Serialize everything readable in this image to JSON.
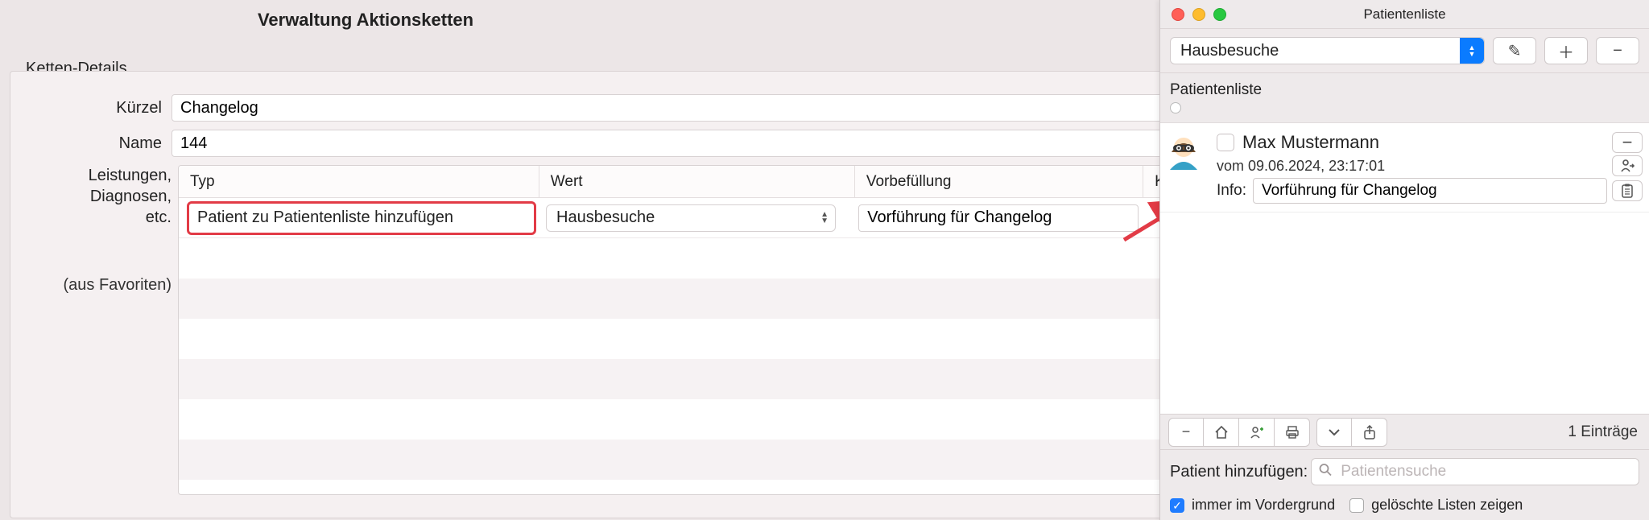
{
  "main": {
    "title": "Verwaltung Aktionsketten",
    "details_label": "Ketten-Details",
    "fields": {
      "kürzel_label": "Kürzel",
      "kürzel_value": "Changelog",
      "name_label": "Name",
      "name_value": "144",
      "multi_label": "Leistungen,\nDiagnosen,\netc.",
      "favoriten_label": "(aus Favoriten)"
    },
    "table": {
      "headers": {
        "typ": "Typ",
        "wert": "Wert",
        "vor": "Vorbefüllung",
        "k": "K"
      },
      "row": {
        "typ": "Patient zu Patientenliste hinzufügen",
        "wert": "Hausbesuche",
        "vor": "Vorführung für Changelog"
      }
    }
  },
  "popover": {
    "title": "Patientenliste",
    "select_value": "Hausbesuche",
    "list_header": "Patientenliste",
    "patient": {
      "name": "Max Mustermann",
      "meta": "vom 09.06.2024, 23:17:01",
      "info_label": "Info:",
      "info_value": "Vorführung für Changelog"
    },
    "count": "1 Einträge",
    "add_label": "Patient hinzufügen:",
    "search_placeholder": "Patientensuche",
    "check1": "immer im Vordergrund",
    "check2": "gelöschte Listen zeigen"
  },
  "icons": {
    "pencil": "✎",
    "plus": "＋",
    "minus": "−",
    "home": "⌂",
    "print": "⎙",
    "chevron_down": "˅",
    "share": "⇪",
    "clipboard": "📋",
    "person": "⍥"
  }
}
